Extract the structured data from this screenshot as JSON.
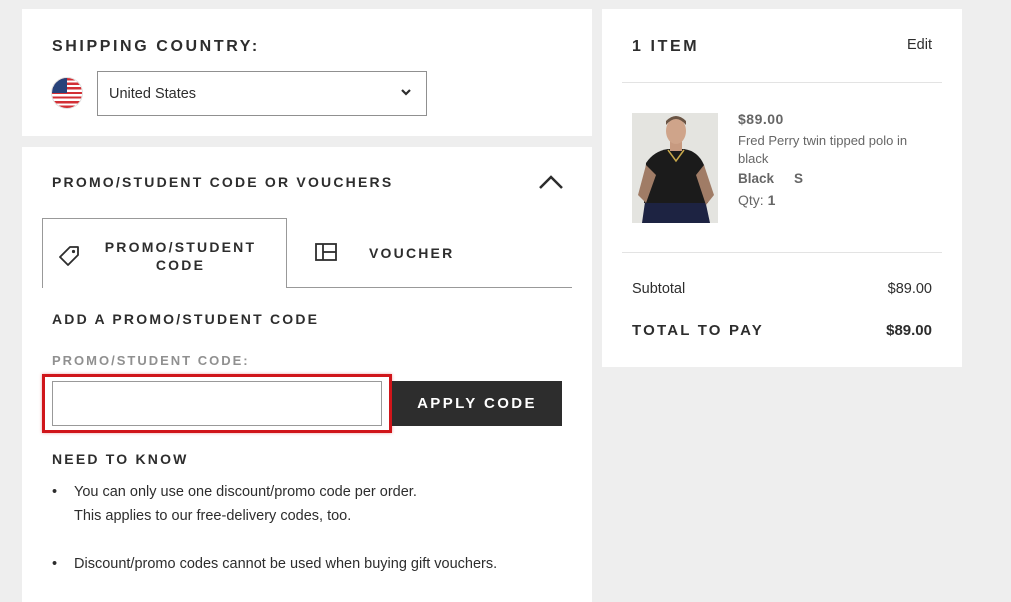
{
  "shipping": {
    "title": "SHIPPING COUNTRY:",
    "country_value": "United States",
    "flag_icon": "us-flag-icon"
  },
  "promo": {
    "section_title": "PROMO/STUDENT CODE OR VOUCHERS",
    "collapse_icon": "chevron-up-icon",
    "tabs": [
      {
        "label": "PROMO/STUDENT CODE",
        "icon": "tag-icon",
        "active": true
      },
      {
        "label": "VOUCHER",
        "icon": "voucher-icon",
        "active": false
      }
    ],
    "add_title": "ADD A PROMO/STUDENT CODE",
    "field_label": "PROMO/STUDENT CODE:",
    "input_value": "",
    "apply_label": "APPLY CODE",
    "highlight_color": "#d0151a",
    "need_to_know_title": "NEED TO KNOW",
    "bullets": [
      {
        "line1": "You can only use one discount/promo code per order.",
        "line2": "This applies to our free-delivery codes, too."
      },
      {
        "line1": "Discount/promo codes cannot be used when buying gift vouchers."
      }
    ]
  },
  "summary": {
    "title": "1 ITEM",
    "edit_label": "Edit",
    "item": {
      "price": "$89.00",
      "name": "Fred Perry twin tipped polo in black",
      "colour": "Black",
      "size": "S",
      "qty_label": "Qty:",
      "qty_value": "1"
    },
    "subtotal_label": "Subtotal",
    "subtotal_value": "$89.00",
    "total_label": "TOTAL TO PAY",
    "total_value": "$89.00"
  }
}
